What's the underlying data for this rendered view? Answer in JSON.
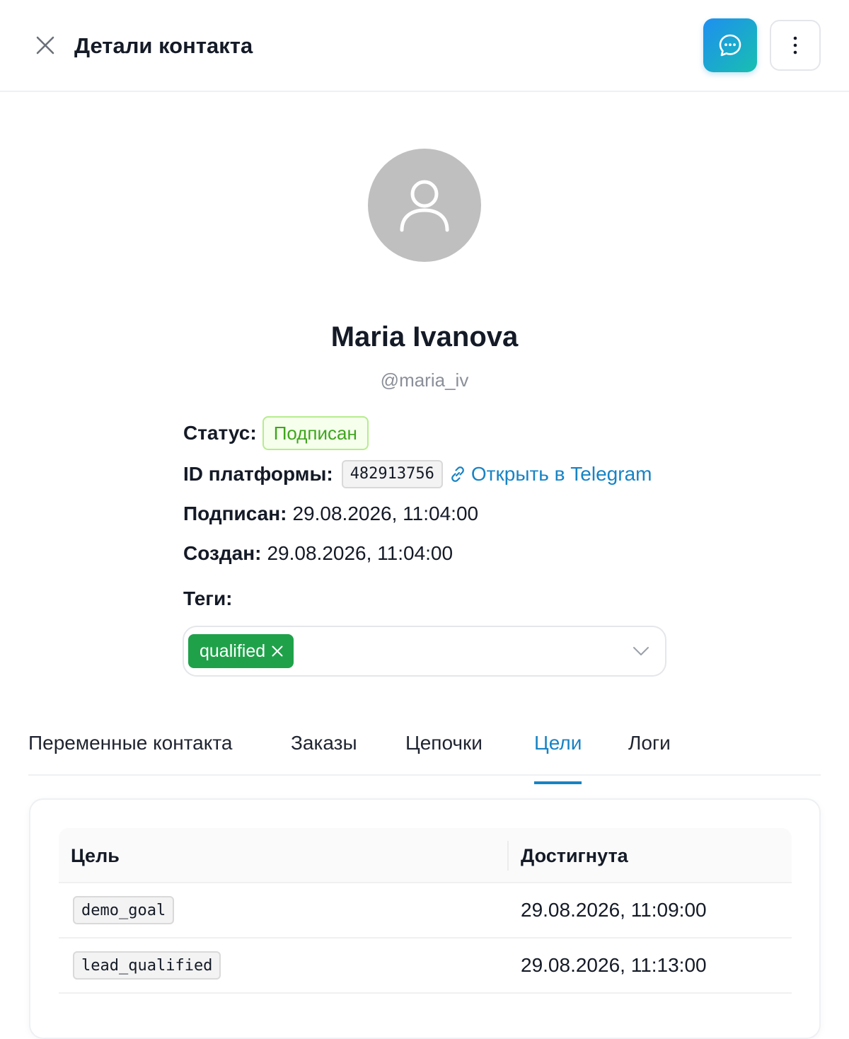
{
  "header": {
    "title": "Детали контакта"
  },
  "contact": {
    "name": "Maria Ivanova",
    "username": "@maria_iv"
  },
  "info": {
    "status_label": "Статус:",
    "status_value": "Подписан",
    "platform_id_label": "ID платформы:",
    "platform_id_value": "482913756",
    "open_link_label": "Открыть в Telegram",
    "subscribed_label": "Подписан:",
    "subscribed_value": "29.08.2026, 11:04:00",
    "created_label": "Создан:",
    "created_value": "29.08.2026, 11:04:00"
  },
  "tags": {
    "label": "Теги:",
    "items": [
      {
        "label": "qualified",
        "color": "#1fa14a"
      }
    ]
  },
  "tabs": [
    {
      "label": "Переменные контакта",
      "active": false
    },
    {
      "label": "Заказы",
      "active": false
    },
    {
      "label": "Цепочки",
      "active": false
    },
    {
      "label": "Цели",
      "active": true
    },
    {
      "label": "Логи",
      "active": false
    }
  ],
  "goals_table": {
    "columns": [
      "Цель",
      "Достигнута"
    ],
    "rows": [
      {
        "goal": "demo_goal",
        "reached": "29.08.2026, 11:09:00"
      },
      {
        "goal": "lead_qualified",
        "reached": "29.08.2026, 11:13:00"
      }
    ]
  },
  "colors": {
    "accent": "#1883c4",
    "status_green": "#3ea51d",
    "tag_green": "#1fa14a"
  },
  "icons": {
    "close": "close-icon",
    "chat": "chat-bubble-icon",
    "more": "more-vertical-icon",
    "avatar": "user-icon",
    "link": "link-icon",
    "chevron": "chevron-down-icon"
  }
}
